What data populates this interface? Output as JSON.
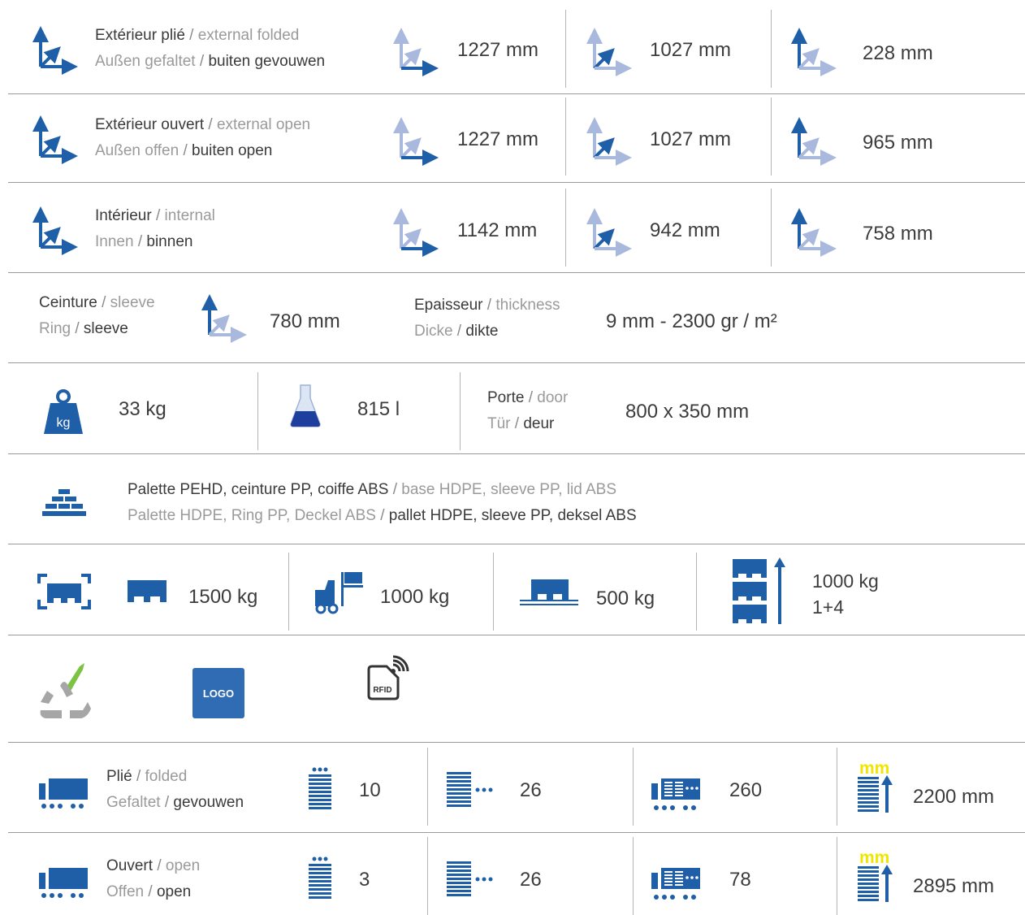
{
  "colors": {
    "primary_blue": "#1f5fa8",
    "light_blue": "#a9b9de",
    "divider": "#9a9a9a",
    "text_dark": "#3a3a3a",
    "text_light": "#9a9a9a",
    "mm_yellow": "#f2e600"
  },
  "dimensions": {
    "rows": [
      {
        "label_fr": "Extérieur plié",
        "label_en": "external folded",
        "label_de": "Außen gefaltet",
        "label_nl": "buiten gevouwen",
        "length": "1227 mm",
        "width": "1027 mm",
        "height": "228 mm"
      },
      {
        "label_fr": "Extérieur ouvert",
        "label_en": "external open",
        "label_de": "Außen offen",
        "label_nl": "buiten open",
        "length": "1227 mm",
        "width": "1027 mm",
        "height": "965 mm"
      },
      {
        "label_fr": "Intérieur",
        "label_en": "internal",
        "label_de": "Innen",
        "label_nl": "binnen",
        "length": "1142 mm",
        "width": "942 mm",
        "height": "758 mm"
      }
    ],
    "icons": [
      "axes-3d-icon",
      "length-axis-icon",
      "width-axis-icon",
      "height-axis-icon"
    ]
  },
  "sleeve": {
    "label_fr": "Ceinture",
    "label_en": "sleeve",
    "label_de": "Ring",
    "label_nl": "sleeve",
    "value": "780 mm"
  },
  "thickness": {
    "label_fr": "Epaisseur",
    "label_en": "thickness",
    "label_de": "Dicke",
    "label_nl": "dikte",
    "value": "9 mm - 2300 gr / m²"
  },
  "weight": {
    "icon": "weight-kg-icon",
    "icon_text": "kg",
    "value": "33 kg"
  },
  "volume": {
    "icon": "flask-icon",
    "value": "815 l"
  },
  "door": {
    "label_fr": "Porte",
    "label_en": "door",
    "label_de": "Tür",
    "label_nl": "deur",
    "value": "800 x 350 mm"
  },
  "material": {
    "icon": "bricks-icon",
    "line1_fr": "Palette PEHD, ceinture PP, coiffe ABS",
    "line1_en": "base HDPE, sleeve PP, lid ABS",
    "line2_de": "Palette HDPE, Ring PP, Deckel ABS",
    "line2_nl": "pallet HDPE, sleeve PP, deksel ABS"
  },
  "loads": {
    "static": "1500 kg",
    "forklift": "1000 kg",
    "racking": "500 kg",
    "stacking": "1000 kg",
    "stacking_count": "1+4"
  },
  "badges": {
    "recycle_icon": "recycle-icon",
    "logo_text": "LOGO",
    "rfid_text": "RFID"
  },
  "transport": {
    "rows": [
      {
        "label_fr": "Plié",
        "label_en": "folded",
        "label_de": "Gefaltet",
        "label_nl": "gevouwen",
        "per_stack": "10",
        "per_row": "26",
        "per_truck": "260",
        "height": "2200 mm"
      },
      {
        "label_fr": "Ouvert",
        "label_en": "open",
        "label_de": "Offen",
        "label_nl": "open",
        "per_stack": "3",
        "per_row": "26",
        "per_truck": "78",
        "height": "2895 mm"
      }
    ],
    "mm_label": "mm"
  },
  "sep": "/"
}
